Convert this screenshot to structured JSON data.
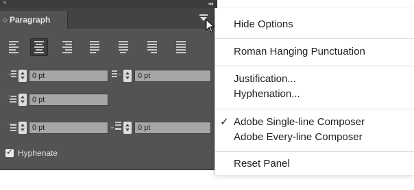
{
  "panel": {
    "close_glyph": "×",
    "collapse_glyph": "◂◂",
    "tab_label": "Paragraph",
    "alignment_buttons": [
      {
        "name": "align-left",
        "selected": false
      },
      {
        "name": "align-center",
        "selected": true
      },
      {
        "name": "align-right",
        "selected": false
      },
      {
        "name": "justify-left",
        "selected": false
      },
      {
        "name": "justify-center",
        "selected": false
      },
      {
        "name": "justify-right",
        "selected": false
      },
      {
        "name": "justify-all",
        "selected": false
      }
    ],
    "fields": {
      "left_indent": "0 pt",
      "right_indent": "0 pt",
      "first_line_indent": "0 pt",
      "space_before": "0 pt",
      "space_after": "0 pt"
    },
    "hyphenate_label": "Hyphenate",
    "hyphenate_checked": true
  },
  "menu": {
    "hide_options": "Hide Options",
    "roman_hanging_punctuation": "Roman Hanging Punctuation",
    "justification": "Justification...",
    "hyphenation": "Hyphenation...",
    "single_line_composer": "Adobe Single-line Composer",
    "every_line_composer": "Adobe Every-line Composer",
    "reset_panel": "Reset Panel",
    "checkmark": "✓"
  }
}
